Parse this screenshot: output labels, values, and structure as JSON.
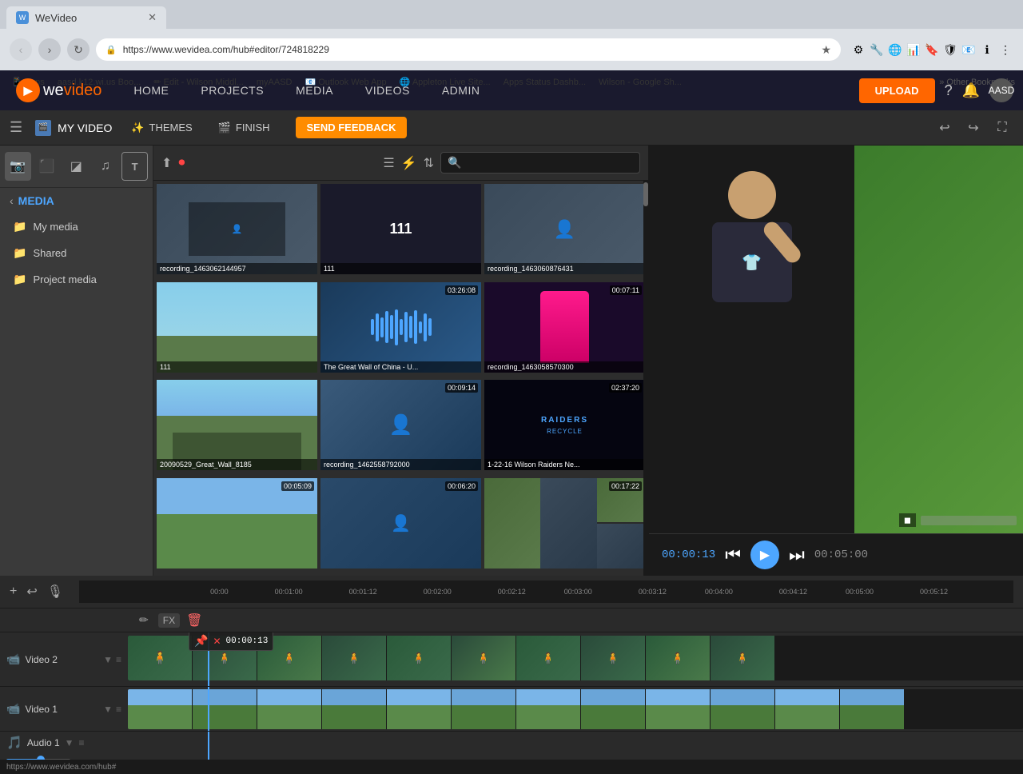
{
  "browser": {
    "tab_title": "WeVideo",
    "url": "https://www.wevidea.com/hub#editor/724818229",
    "bookmarks": [
      "Apps",
      "aasd.k12.wi.us Boo...",
      "Edit - Wilson Middl...",
      "myAASD",
      "Outlook Web App",
      "Appleton Live Site...",
      "Apps Status Dashb...",
      "Wilson - Google Sh...",
      "Other Bookmarks"
    ]
  },
  "app": {
    "logo": "WeVideo",
    "nav": [
      "HOME",
      "PROJECTS",
      "MEDIA",
      "VIDEOS",
      "ADMIN"
    ],
    "upload_btn": "UPLOAD",
    "user_initials": "AASD"
  },
  "toolbar": {
    "project_name": "MY VIDEO",
    "themes_label": "THEMES",
    "finish_label": "FINISH",
    "feedback_label": "SEND FEEDBACK"
  },
  "media_panel": {
    "title": "MEDIA",
    "sections": [
      "My media",
      "Shared",
      "Project media"
    ]
  },
  "media_grid": {
    "items": [
      {
        "title": "recording_1463062144957",
        "duration": "",
        "type": "recording"
      },
      {
        "title": "111",
        "duration": "",
        "type": "text"
      },
      {
        "title": "recording_1463060876431",
        "duration": "",
        "type": "recording"
      },
      {
        "title": "111",
        "duration": "",
        "type": "wall"
      },
      {
        "title": "The Great Wall of China - U...",
        "duration": "03:26:08",
        "type": "audio"
      },
      {
        "title": "recording_1463058570300",
        "duration": "00:07:11",
        "type": "dance"
      },
      {
        "title": "20090529_Great_Wall_8185",
        "duration": "",
        "type": "outdoor"
      },
      {
        "title": "recording_1462558792000",
        "duration": "00:09:14",
        "type": "recording2"
      },
      {
        "title": "1-22-16 Wilson Raiders Ne...",
        "duration": "02:37:20",
        "type": "dark"
      },
      {
        "title": "",
        "duration": "00:05:09",
        "type": "outdoor2"
      },
      {
        "title": "",
        "duration": "00:06:20",
        "type": "recording3"
      },
      {
        "title": "",
        "duration": "00:17:22",
        "type": "mixed"
      }
    ]
  },
  "preview": {
    "time_current": "00:00:13",
    "time_total": "00:05:00"
  },
  "timeline": {
    "tracks": [
      "Video 2",
      "Video 1",
      "Audio 1"
    ],
    "clip_popup_time": "00:00:13",
    "ruler_marks": [
      "00:00",
      "00:01:00",
      "00:01:12",
      "00:02:00",
      "00:02:12",
      "00:03:00",
      "00:03:12",
      "00:04:00",
      "00:04:12",
      "00:05:00",
      "00:05:12"
    ]
  },
  "icons": {
    "upload": "⬆",
    "record": "⏺",
    "list_view": "☰",
    "filter": "⚡",
    "sort": "⇅",
    "search": "🔍",
    "back": "‹",
    "folder": "📁",
    "video_track": "📹",
    "audio_track": "🎵",
    "scissors": "✂",
    "fx": "FX",
    "trash": "🗑",
    "pencil": "✏",
    "play": "▶",
    "pause": "⏸",
    "skip_back": "⏮",
    "skip_fwd": "⏭",
    "undo": "↩",
    "redo": "↪",
    "mic": "🎙",
    "plus": "+",
    "pin": "📌",
    "x_mark": "✕"
  }
}
